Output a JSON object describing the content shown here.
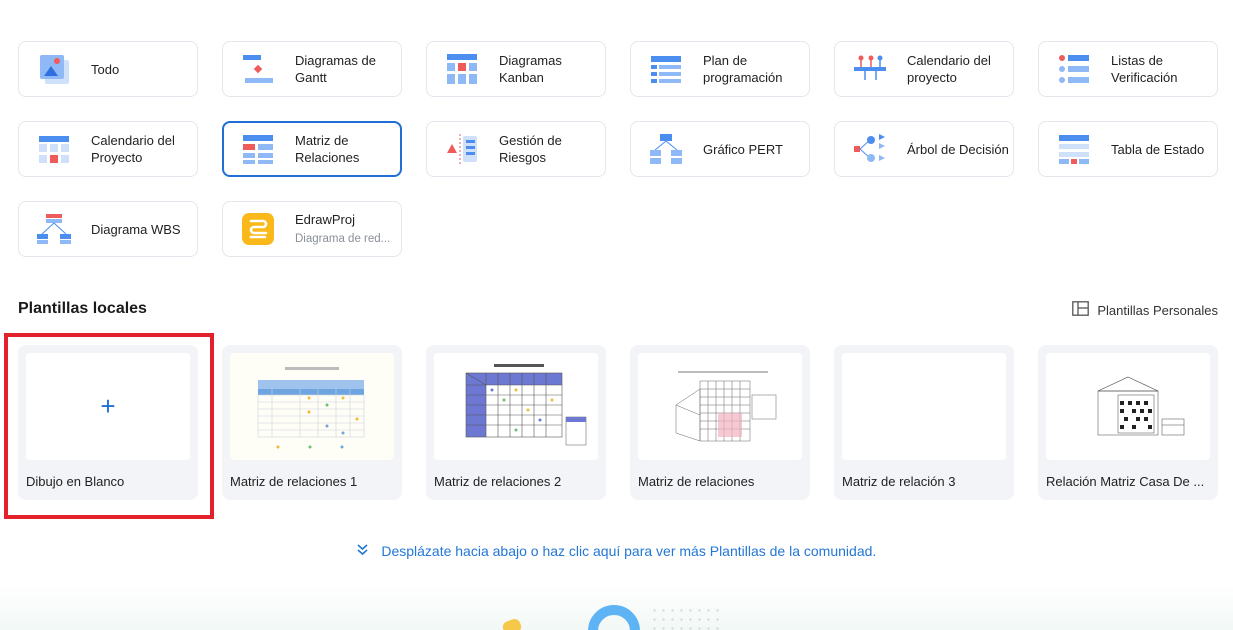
{
  "categories": [
    {
      "title": "Todo",
      "subtitle": "",
      "icon": "all-templates-icon"
    },
    {
      "title": "Diagramas de Gantt",
      "subtitle": "",
      "icon": "gantt-icon"
    },
    {
      "title": "Diagramas Kanban",
      "subtitle": "",
      "icon": "kanban-icon"
    },
    {
      "title": "Plan de programación",
      "subtitle": "",
      "icon": "schedule-icon"
    },
    {
      "title": "Calendario del proyecto",
      "subtitle": "",
      "icon": "timeline-icon"
    },
    {
      "title": "Listas de Verificación",
      "subtitle": "",
      "icon": "checklist-icon"
    },
    {
      "title": "Calendario del Proyecto",
      "subtitle": "",
      "icon": "calendar-icon"
    },
    {
      "title": "Matriz de Relaciones",
      "subtitle": "",
      "icon": "matrix-icon"
    },
    {
      "title": "Gestión de Riesgos",
      "subtitle": "",
      "icon": "risk-icon"
    },
    {
      "title": "Gráfico PERT",
      "subtitle": "",
      "icon": "pert-icon"
    },
    {
      "title": "Árbol de Decisión",
      "subtitle": "",
      "icon": "decision-tree-icon"
    },
    {
      "title": "Tabla de Estado",
      "subtitle": "",
      "icon": "status-table-icon"
    },
    {
      "title": "Diagrama WBS",
      "subtitle": "",
      "icon": "wbs-icon"
    },
    {
      "title": "EdrawProj",
      "subtitle": "Diagrama de red...",
      "icon": "edrawproj-app-icon"
    }
  ],
  "selected_category": "Matriz de Relaciones",
  "local_templates": {
    "title": "Plantillas locales",
    "personal_link": "Plantillas Personales",
    "items": [
      {
        "label": "Dibujo en Blanco"
      },
      {
        "label": "Matriz de relaciones  1"
      },
      {
        "label": "Matriz de relaciones 2"
      },
      {
        "label": "Matriz de relaciones"
      },
      {
        "label": "Matriz de relación 3"
      },
      {
        "label": "Relación Matriz Casa De ..."
      }
    ],
    "highlighted": "Dibujo en Blanco"
  },
  "community_link": "Desplázate hacia abajo o haz clic aquí para ver más Plantillas de la comunidad.",
  "colors": {
    "accent": "#1f6fd6",
    "link": "#2377d6",
    "highlight_box": "#e1222d",
    "icon_blue": "#4b8ef0",
    "icon_red": "#ef5b5b"
  }
}
